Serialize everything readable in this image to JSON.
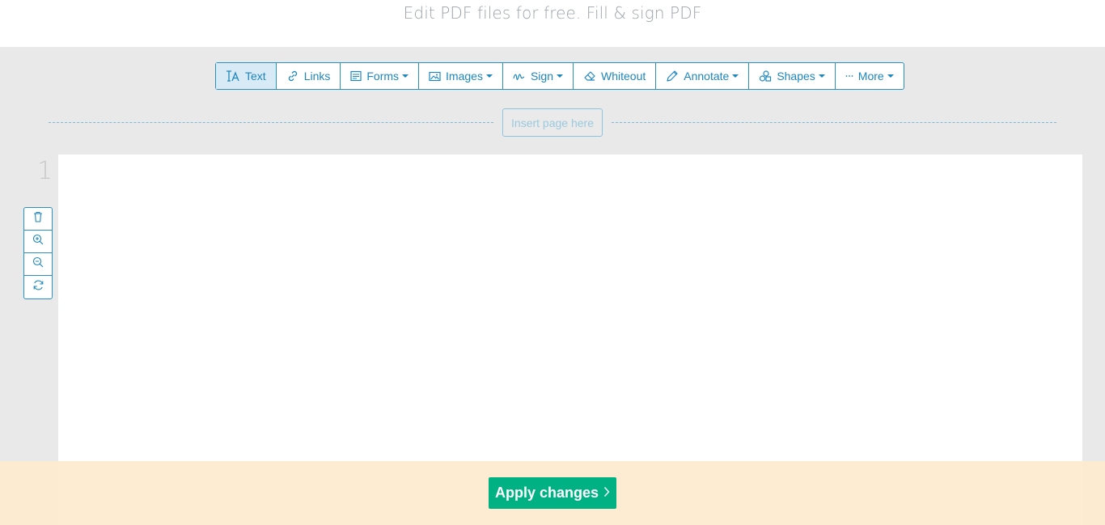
{
  "header": {
    "subtitle": "Edit PDF files for free. Fill & sign PDF"
  },
  "toolbar": {
    "tools": [
      {
        "label": "Text",
        "icon": "text-tool-icon",
        "active": true,
        "dropdown": false
      },
      {
        "label": "Links",
        "icon": "link-icon",
        "active": false,
        "dropdown": false
      },
      {
        "label": "Forms",
        "icon": "form-icon",
        "active": false,
        "dropdown": true
      },
      {
        "label": "Images",
        "icon": "image-icon",
        "active": false,
        "dropdown": true
      },
      {
        "label": "Sign",
        "icon": "signature-icon",
        "active": false,
        "dropdown": true
      },
      {
        "label": "Whiteout",
        "icon": "eraser-icon",
        "active": false,
        "dropdown": false
      },
      {
        "label": "Annotate",
        "icon": "pencil-icon",
        "active": false,
        "dropdown": true
      },
      {
        "label": "Shapes",
        "icon": "shapes-icon",
        "active": false,
        "dropdown": true
      },
      {
        "label": "More",
        "icon": "more-dots-icon",
        "active": false,
        "dropdown": true
      }
    ]
  },
  "insert_page": {
    "label": "Insert page here"
  },
  "page": {
    "number": "1",
    "tools": [
      {
        "icon": "trash-icon"
      },
      {
        "icon": "zoom-in-icon"
      },
      {
        "icon": "zoom-out-icon"
      },
      {
        "icon": "rotate-icon"
      }
    ]
  },
  "footer": {
    "apply_label": "Apply changes"
  },
  "colors": {
    "accent": "#1d87bd",
    "apply_button": "#00b283",
    "footer_bg": "#fdebcd",
    "canvas_bg": "#e9e9e9"
  }
}
